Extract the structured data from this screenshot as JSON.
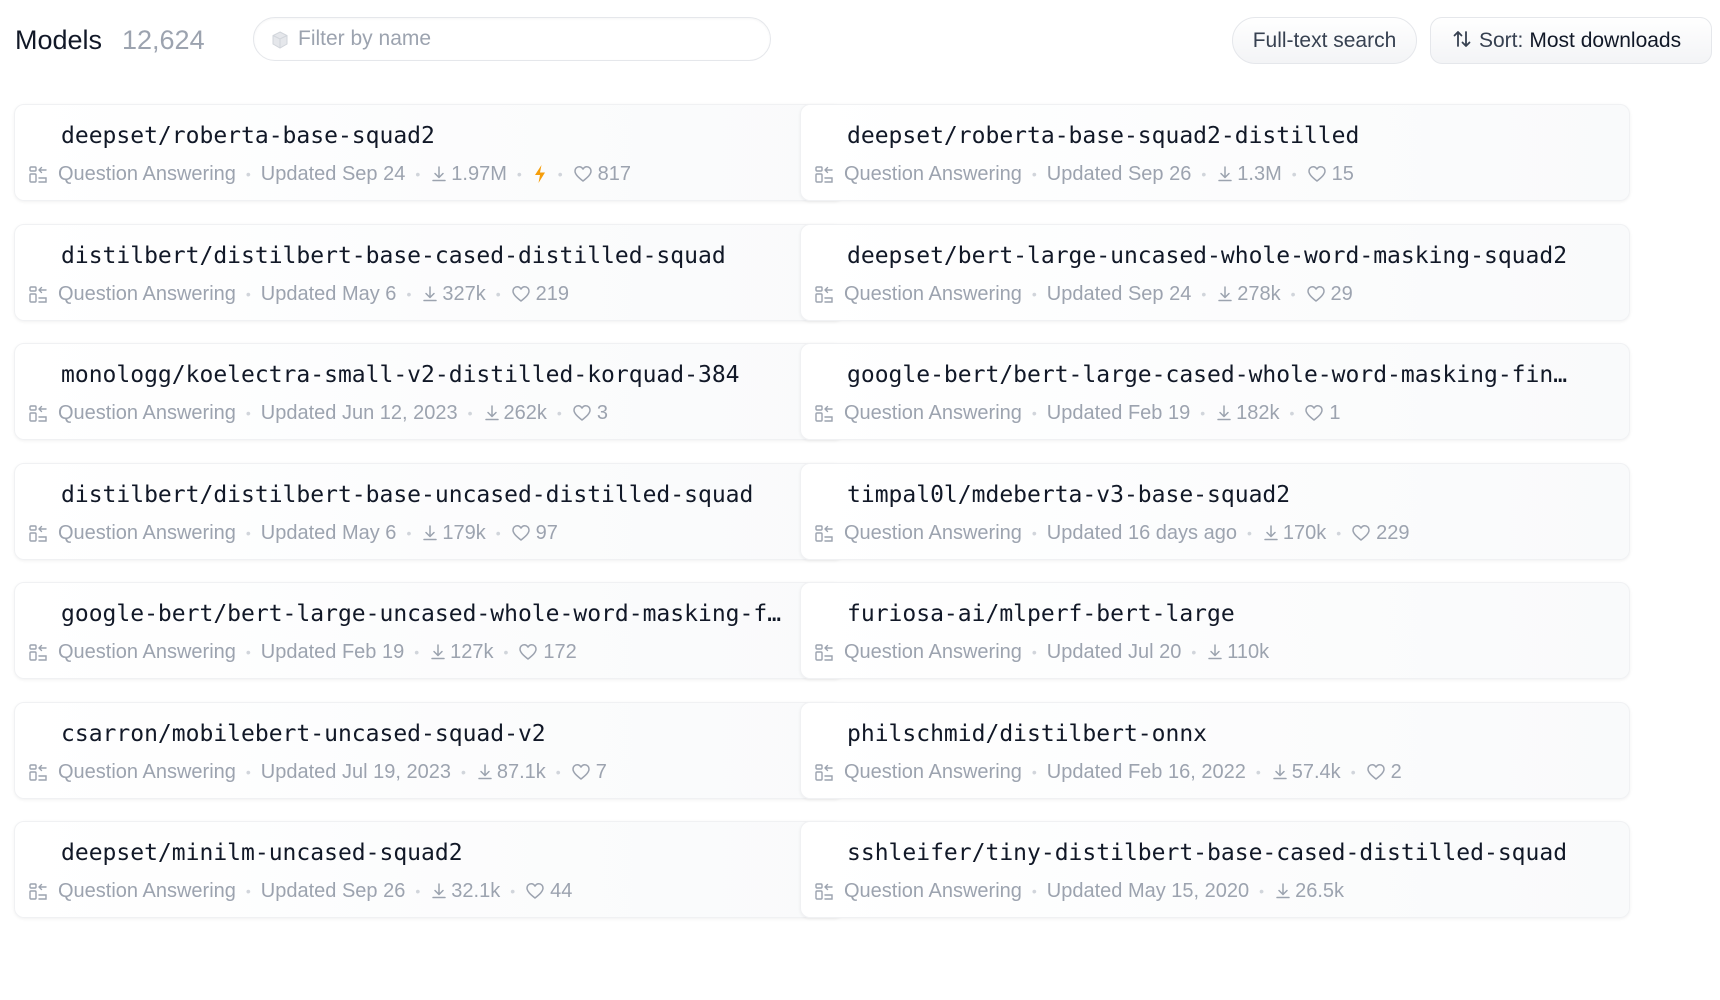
{
  "header": {
    "title": "Models",
    "count": "12,624",
    "filter_placeholder": "Filter by name",
    "fulltext_label": "Full-text search",
    "sort_prefix": "Sort:",
    "sort_value": "Most downloads"
  },
  "models": [
    {
      "name": "deepset/roberta-base-squad2",
      "task": "Question Answering",
      "updated": "Updated Sep 24",
      "downloads": "1.97M",
      "lightning": true,
      "likes": "817"
    },
    {
      "name": "deepset/roberta-base-squad2-distilled",
      "task": "Question Answering",
      "updated": "Updated Sep 26",
      "downloads": "1.3M",
      "lightning": false,
      "likes": "15"
    },
    {
      "name": "distilbert/distilbert-base-cased-distilled-squad",
      "task": "Question Answering",
      "updated": "Updated May 6",
      "downloads": "327k",
      "lightning": false,
      "likes": "219"
    },
    {
      "name": "deepset/bert-large-uncased-whole-word-masking-squad2",
      "task": "Question Answering",
      "updated": "Updated Sep 24",
      "downloads": "278k",
      "lightning": false,
      "likes": "29"
    },
    {
      "name": "monologg/koelectra-small-v2-distilled-korquad-384",
      "task": "Question Answering",
      "updated": "Updated Jun 12, 2023",
      "downloads": "262k",
      "lightning": false,
      "likes": "3"
    },
    {
      "name": "google-bert/bert-large-cased-whole-word-masking-fin…",
      "task": "Question Answering",
      "updated": "Updated Feb 19",
      "downloads": "182k",
      "lightning": false,
      "likes": "1"
    },
    {
      "name": "distilbert/distilbert-base-uncased-distilled-squad",
      "task": "Question Answering",
      "updated": "Updated May 6",
      "downloads": "179k",
      "lightning": false,
      "likes": "97"
    },
    {
      "name": "timpal0l/mdeberta-v3-base-squad2",
      "task": "Question Answering",
      "updated": "Updated 16 days ago",
      "downloads": "170k",
      "lightning": false,
      "likes": "229"
    },
    {
      "name": "google-bert/bert-large-uncased-whole-word-masking-f…",
      "task": "Question Answering",
      "updated": "Updated Feb 19",
      "downloads": "127k",
      "lightning": false,
      "likes": "172"
    },
    {
      "name": "furiosa-ai/mlperf-bert-large",
      "task": "Question Answering",
      "updated": "Updated Jul 20",
      "downloads": "110k",
      "lightning": false,
      "likes": ""
    },
    {
      "name": "csarron/mobilebert-uncased-squad-v2",
      "task": "Question Answering",
      "updated": "Updated Jul 19, 2023",
      "downloads": "87.1k",
      "lightning": false,
      "likes": "7"
    },
    {
      "name": "philschmid/distilbert-onnx",
      "task": "Question Answering",
      "updated": "Updated Feb 16, 2022",
      "downloads": "57.4k",
      "lightning": false,
      "likes": "2"
    },
    {
      "name": "deepset/minilm-uncased-squad2",
      "task": "Question Answering",
      "updated": "Updated Sep 26",
      "downloads": "32.1k",
      "lightning": false,
      "likes": "44"
    },
    {
      "name": "sshleifer/tiny-distilbert-base-cased-distilled-squad",
      "task": "Question Answering",
      "updated": "Updated May 15, 2020",
      "downloads": "26.5k",
      "lightning": false,
      "likes": ""
    }
  ],
  "icons": {
    "filter": "cube-icon",
    "sort": "sort-arrows-icon",
    "task": "question-answering-icon",
    "downloads": "download-icon",
    "likes": "heart-icon",
    "inference": "lightning-icon"
  },
  "colors": {
    "muted_text": "#9ca3af",
    "lightning": "#f59e0b"
  }
}
